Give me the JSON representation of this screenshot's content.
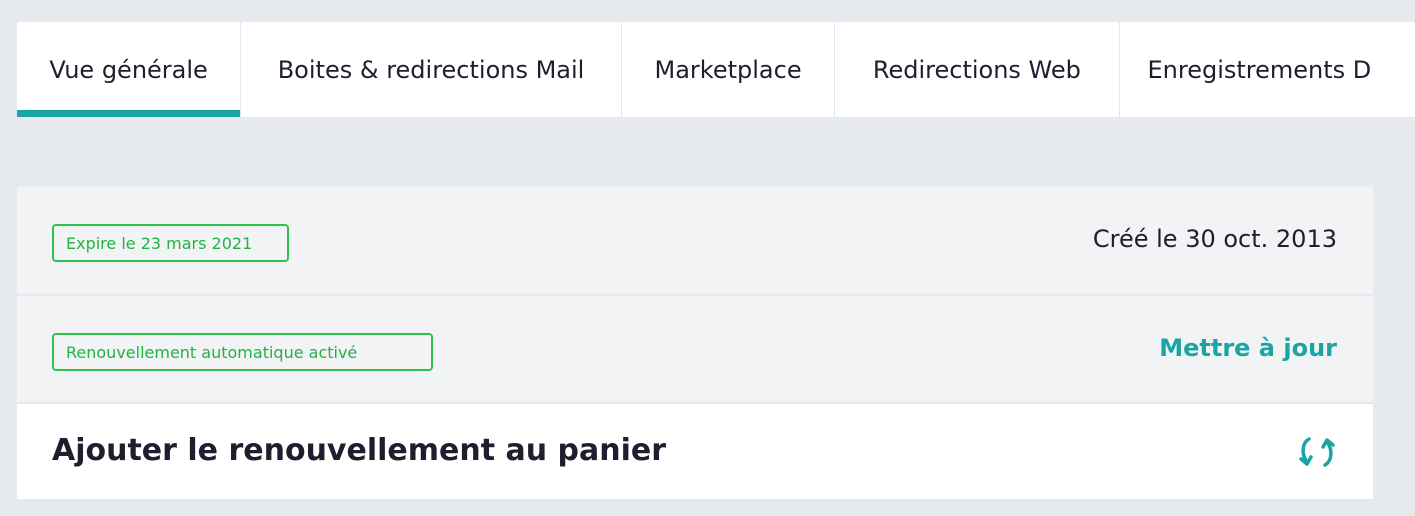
{
  "tabs": [
    {
      "label": "Vue générale",
      "active": true
    },
    {
      "label": "Boites & redirections Mail",
      "active": false
    },
    {
      "label": "Marketplace",
      "active": false
    },
    {
      "label": "Redirections Web",
      "active": false
    },
    {
      "label": "Enregistrements D",
      "active": false
    }
  ],
  "summary": {
    "expire_badge": "Expire le 23 mars 2021",
    "created_text": "Créé le 30 oct. 2013",
    "renewal_badge": "Renouvellement automatique activé",
    "update_link": "Mettre à jour",
    "cart_label": "Ajouter le renouvellement au panier",
    "cart_icon": "refresh-icon"
  },
  "colors": {
    "accent": "#1aa4a4",
    "badge_green": "#2ec34d",
    "page_background": "#e6e9ed"
  }
}
